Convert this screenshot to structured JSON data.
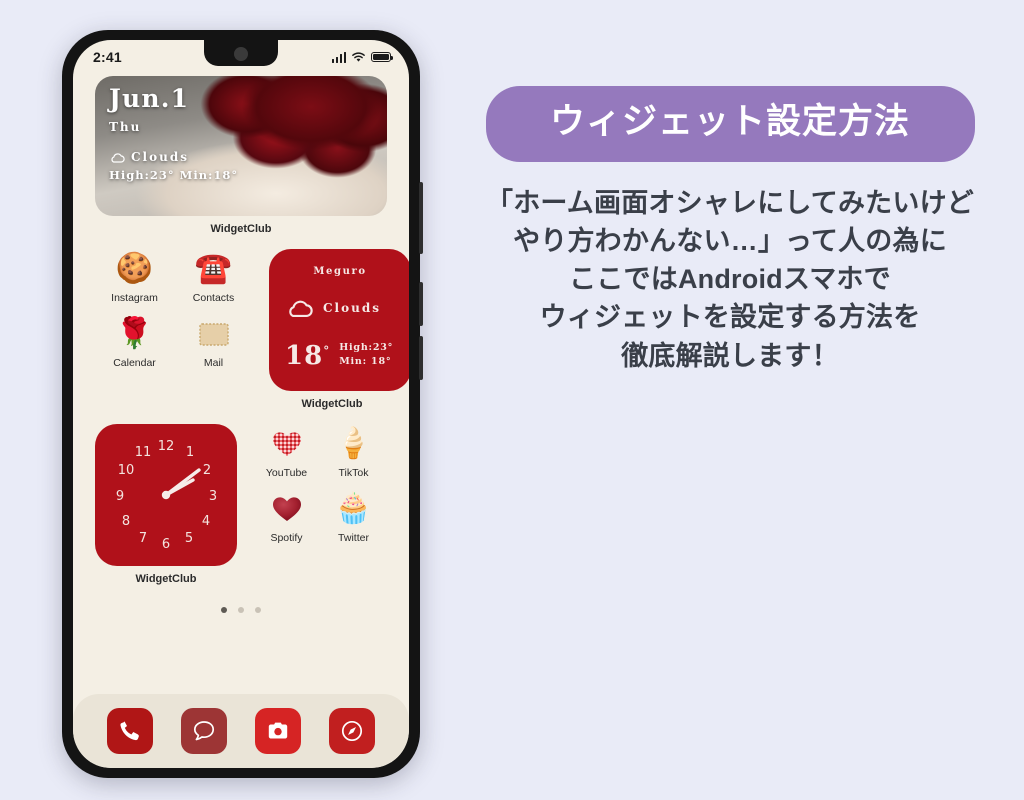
{
  "background_color": "#e9ebf7",
  "phone": {
    "status_bar": {
      "time": "2:41",
      "signal_icon": "signal-bars-icon",
      "wifi_icon": "wifi-icon",
      "battery_icon": "battery-full-icon"
    },
    "photo_widget": {
      "date": "Jun.1",
      "weekday": "Thu",
      "condition": "Clouds",
      "condition_icon": "cloud-icon",
      "high_low": "High:23° Min:18°",
      "label": "WidgetClub"
    },
    "apps_top": [
      {
        "name": "Instagram",
        "icon": "heart-cookie-icon",
        "glyph": "🍪"
      },
      {
        "name": "Contacts",
        "icon": "telephone-icon",
        "glyph": "☎️"
      },
      {
        "name": "Calendar",
        "icon": "rose-icon",
        "glyph": "🌹"
      },
      {
        "name": "Mail",
        "icon": "envelope-icon",
        "glyph": "🗒"
      }
    ],
    "weather_widget": {
      "city": "Meguro",
      "condition": "Clouds",
      "condition_icon": "cloud-icon",
      "temperature": "18",
      "degree": "°",
      "high": "High:23°",
      "min": "Min: 18°",
      "label": "WidgetClub",
      "color": "#b0111a"
    },
    "clock_widget": {
      "label": "WidgetClub",
      "color": "#b0111a",
      "numerals": [
        "12",
        "1",
        "2",
        "3",
        "4",
        "5",
        "6",
        "7",
        "8",
        "9",
        "10",
        "11"
      ],
      "hour_angle": 73,
      "minute_angle": 42
    },
    "apps_bottom": [
      {
        "name": "YouTube",
        "icon": "gingham-heart-icon",
        "glyph": "❤️"
      },
      {
        "name": "TikTok",
        "icon": "ice-cream-cone-icon",
        "glyph": "🍦"
      },
      {
        "name": "Spotify",
        "icon": "red-heart-icon",
        "glyph": "❤"
      },
      {
        "name": "Twitter",
        "icon": "cupcake-icon",
        "glyph": "🧁"
      }
    ],
    "page_dots": {
      "count": 3,
      "active_index": 0
    },
    "dock": [
      {
        "name": "Phone",
        "icon": "phone-handset-icon",
        "color": "#b01616"
      },
      {
        "name": "Messages",
        "icon": "speech-bubble-icon",
        "color": "#9d3535"
      },
      {
        "name": "Camera",
        "icon": "camera-icon",
        "color": "#d62424"
      },
      {
        "name": "Browser",
        "icon": "compass-icon",
        "color": "#c11f1f"
      }
    ]
  },
  "panel": {
    "badge": {
      "title": "ウィジェット設定方法",
      "color": "#9579bd",
      "text_color": "#ffffff"
    },
    "description_lines": [
      "「ホーム画面オシャレにしてみたいけど",
      "やり方わかんない…」って人の為に",
      "ここではAndroidスマホで",
      "ウィジェットを設定する方法を",
      "徹底解説します！"
    ]
  }
}
